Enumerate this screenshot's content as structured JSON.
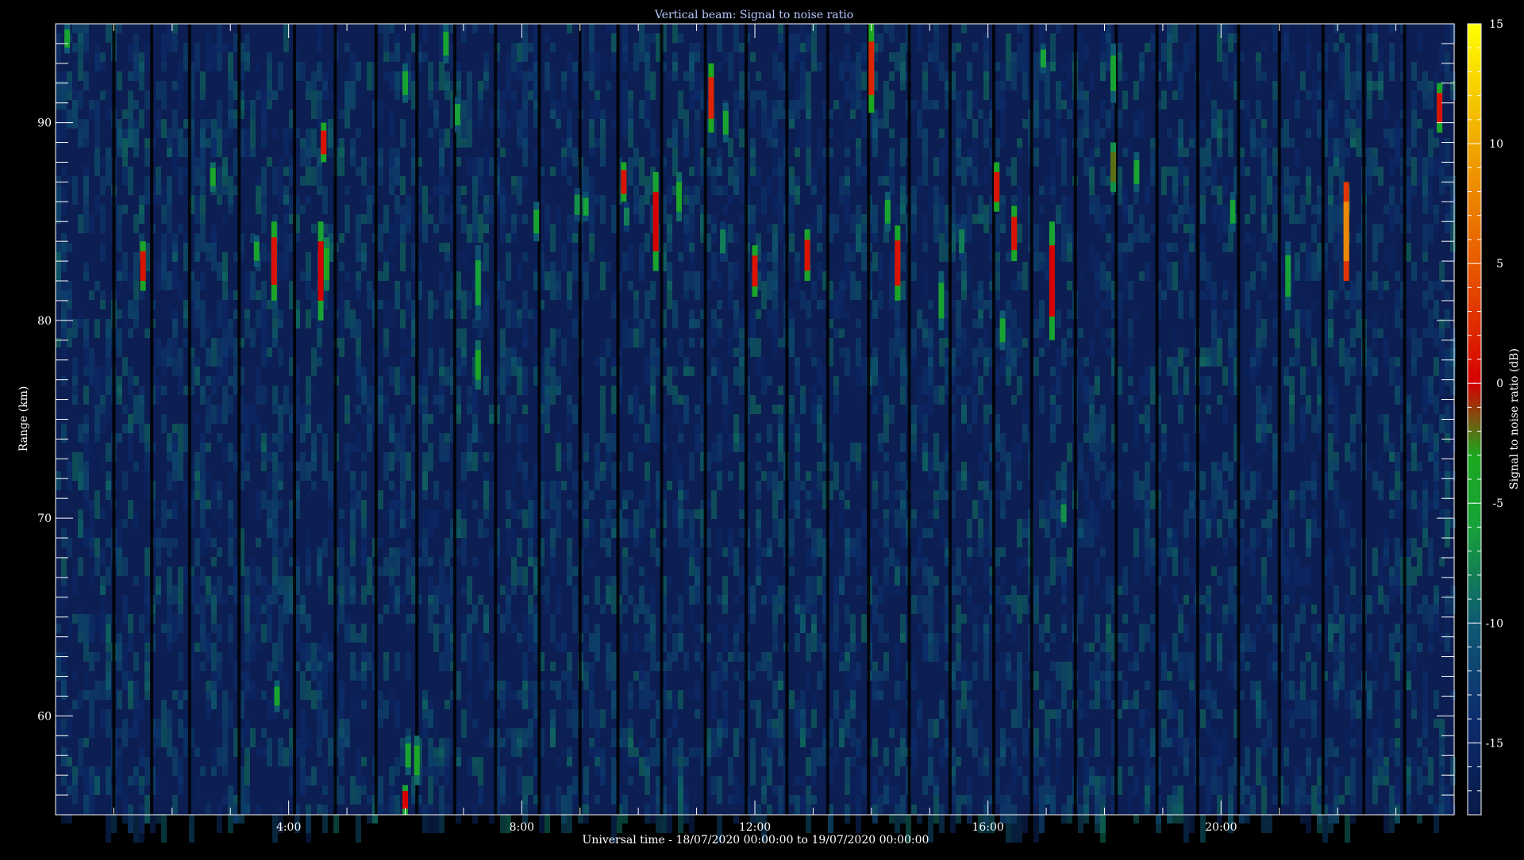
{
  "chart_data": {
    "type": "heatmap",
    "title": "Vertical beam: Signal to noise ratio",
    "xlabel": "Universal time - 18/07/2020 00:00:00 to 19/07/2020 00:00:00",
    "ylabel": "Range (km)",
    "colorbar_label": "Signal to noise ratio (dB)",
    "x_unit": "hours UT",
    "xlim": [
      0,
      24
    ],
    "ylim": [
      55,
      95
    ],
    "clim": [
      -18,
      15
    ],
    "x_ticks": [
      {
        "value": 4,
        "label": "4:00"
      },
      {
        "value": 8,
        "label": "8:00"
      },
      {
        "value": 12,
        "label": "12:00"
      },
      {
        "value": 16,
        "label": "16:00"
      },
      {
        "value": 20,
        "label": "20:00"
      }
    ],
    "y_ticks": [
      {
        "value": 60,
        "label": "60"
      },
      {
        "value": 70,
        "label": "70"
      },
      {
        "value": 80,
        "label": "80"
      },
      {
        "value": 90,
        "label": "90"
      }
    ],
    "colorbar_ticks": [
      {
        "value": 15,
        "label": "15"
      },
      {
        "value": 10,
        "label": "10"
      },
      {
        "value": 5,
        "label": "5"
      },
      {
        "value": 0,
        "label": "0"
      },
      {
        "value": -5,
        "label": "-5"
      },
      {
        "value": -10,
        "label": "-10"
      },
      {
        "value": -15,
        "label": "-15"
      }
    ],
    "background_level_db": -16,
    "data_gaps_hours": [
      1.0,
      1.65,
      2.3,
      3.15,
      4.1,
      4.8,
      5.5,
      6.2,
      6.85,
      7.55,
      8.3,
      9.0,
      9.65,
      10.4,
      11.15,
      11.85,
      12.55,
      13.25,
      13.95,
      14.65,
      15.35,
      16.1,
      16.75,
      17.5,
      18.2,
      18.9,
      19.6,
      20.3,
      21.0,
      21.75,
      22.45,
      23.15
    ],
    "echoes": [
      {
        "t": 0.2,
        "r0": 93.5,
        "r1": 95,
        "snr": -5
      },
      {
        "t": 1.5,
        "r0": 81.5,
        "r1": 84,
        "snr": 1
      },
      {
        "t": 2.7,
        "r0": 86.5,
        "r1": 88,
        "snr": -4
      },
      {
        "t": 3.45,
        "r0": 82.7,
        "r1": 84.3,
        "snr": -5
      },
      {
        "t": 3.75,
        "r0": 81,
        "r1": 85,
        "snr": 1
      },
      {
        "t": 3.8,
        "r0": 60.2,
        "r1": 61.8,
        "snr": -5
      },
      {
        "t": 4.55,
        "r0": 80,
        "r1": 85,
        "snr": 0
      },
      {
        "t": 4.6,
        "r0": 88,
        "r1": 90,
        "snr": 1
      },
      {
        "t": 4.65,
        "r0": 81.5,
        "r1": 84.2,
        "snr": -3
      },
      {
        "t": 6.0,
        "r0": 55,
        "r1": 56.5,
        "snr": 0
      },
      {
        "t": 6.05,
        "r0": 57,
        "r1": 59,
        "snr": -5
      },
      {
        "t": 6.2,
        "r0": 56.5,
        "r1": 59,
        "snr": -4
      },
      {
        "t": 6.0,
        "r0": 91,
        "r1": 93,
        "snr": -5
      },
      {
        "t": 6.7,
        "r0": 93,
        "r1": 95,
        "snr": -5
      },
      {
        "t": 6.9,
        "r0": 89.5,
        "r1": 91.3,
        "snr": -6
      },
      {
        "t": 7.25,
        "r0": 76.5,
        "r1": 79,
        "snr": -4
      },
      {
        "t": 7.25,
        "r0": 80,
        "r1": 83.8,
        "snr": -6
      },
      {
        "t": 8.25,
        "r0": 84,
        "r1": 86,
        "snr": -5
      },
      {
        "t": 8.95,
        "r0": 85,
        "r1": 86.7,
        "snr": -7
      },
      {
        "t": 9.1,
        "r0": 85,
        "r1": 86.5,
        "snr": -6
      },
      {
        "t": 9.75,
        "r0": 86,
        "r1": 88,
        "snr": 1
      },
      {
        "t": 9.8,
        "r0": 84.5,
        "r1": 86,
        "snr": -8
      },
      {
        "t": 10.3,
        "r0": 82.5,
        "r1": 87.5,
        "snr": 0
      },
      {
        "t": 10.7,
        "r0": 85,
        "r1": 87.5,
        "snr": -4
      },
      {
        "t": 11.25,
        "r0": 89.5,
        "r1": 93,
        "snr": 2
      },
      {
        "t": 11.5,
        "r0": 89,
        "r1": 91,
        "snr": -5
      },
      {
        "t": 11.45,
        "r0": 83,
        "r1": 85,
        "snr": -8
      },
      {
        "t": 12.0,
        "r0": 81.2,
        "r1": 83.8,
        "snr": 1
      },
      {
        "t": 12.9,
        "r0": 82,
        "r1": 84.6,
        "snr": 1
      },
      {
        "t": 14.0,
        "r0": 90.5,
        "r1": 95,
        "snr": 2
      },
      {
        "t": 14.28,
        "r0": 84.5,
        "r1": 86.5,
        "snr": -5
      },
      {
        "t": 14.45,
        "r0": 81,
        "r1": 84.8,
        "snr": 1
      },
      {
        "t": 15.2,
        "r0": 79.5,
        "r1": 82.5,
        "snr": -5
      },
      {
        "t": 15.55,
        "r0": 83,
        "r1": 85,
        "snr": -8
      },
      {
        "t": 16.15,
        "r0": 85.5,
        "r1": 88,
        "snr": 1
      },
      {
        "t": 16.25,
        "r0": 78.5,
        "r1": 80.5,
        "snr": -5
      },
      {
        "t": 16.45,
        "r0": 83,
        "r1": 85.8,
        "snr": 1
      },
      {
        "t": 16.95,
        "r0": 92.5,
        "r1": 94,
        "snr": -6
      },
      {
        "t": 17.1,
        "r0": 79,
        "r1": 85,
        "snr": 0
      },
      {
        "t": 18.15,
        "r0": 86.5,
        "r1": 89,
        "snr": -2
      },
      {
        "t": 18.15,
        "r0": 91,
        "r1": 94,
        "snr": -5
      },
      {
        "t": 18.55,
        "r0": 86.5,
        "r1": 88.5,
        "snr": -5
      },
      {
        "t": 20.2,
        "r0": 84.5,
        "r1": 86.5,
        "snr": -6
      },
      {
        "t": 21.15,
        "r0": 80.5,
        "r1": 84,
        "snr": -6
      },
      {
        "t": 22.15,
        "r0": 82,
        "r1": 87,
        "snr": 8
      },
      {
        "t": 23.75,
        "r0": 89.5,
        "r1": 92,
        "snr": 1
      },
      {
        "t": 17.3,
        "r0": 69.5,
        "r1": 71,
        "snr": -7
      }
    ],
    "colormap": [
      {
        "value": -18,
        "color": "#091a48"
      },
      {
        "value": -14,
        "color": "#0d2c6e"
      },
      {
        "value": -10,
        "color": "#0e5a72"
      },
      {
        "value": -6,
        "color": "#17a23a"
      },
      {
        "value": -3,
        "color": "#1da81f"
      },
      {
        "value": 0,
        "color": "#d60000"
      },
      {
        "value": 5,
        "color": "#e85a00"
      },
      {
        "value": 10,
        "color": "#f0a800"
      },
      {
        "value": 15,
        "color": "#ffff00"
      }
    ],
    "colors": {
      "background": "#000000",
      "axes": "#ffffff",
      "title": "#b9c8ff",
      "gap": "#000000",
      "plot_bg": "#0c1e52"
    }
  }
}
